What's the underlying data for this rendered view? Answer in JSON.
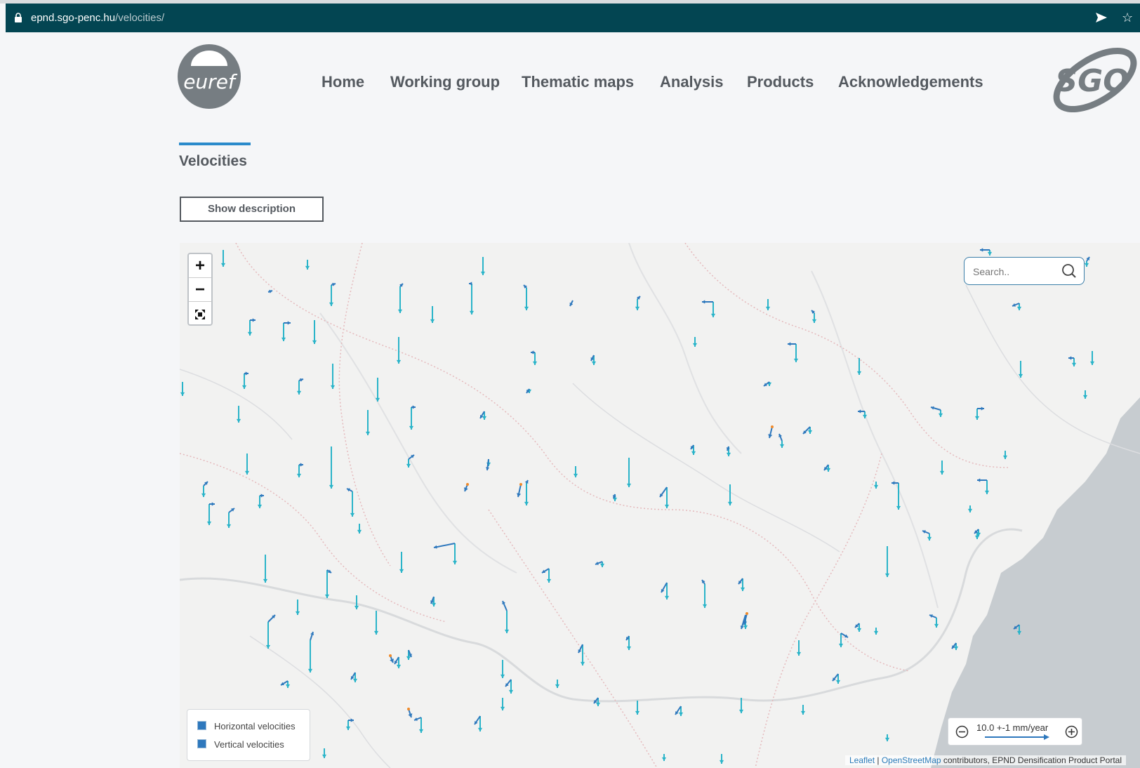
{
  "browser": {
    "url_host": "epnd.sgo-penc.hu",
    "url_path": "/velocities/"
  },
  "brand": {
    "euref_logo_text": "euref",
    "sgo_logo_text": "SGO"
  },
  "nav": {
    "items": [
      {
        "label": "Home"
      },
      {
        "label": "Working group"
      },
      {
        "label": "Thematic maps"
      },
      {
        "label": "Analysis"
      },
      {
        "label": "Products"
      },
      {
        "label": "Acknowledgements"
      }
    ]
  },
  "page": {
    "title": "Velocities",
    "show_description_label": "Show description"
  },
  "map": {
    "zoom_in_label": "+",
    "zoom_out_label": "−",
    "search_placeholder": "Search..",
    "legend": {
      "horizontal_label": "Horizontal velocities",
      "vertical_label": "Vertical velocities"
    },
    "scale_label": "10.0 +-1 mm/year",
    "attribution": {
      "leaflet": "Leaflet",
      "separator": " | ",
      "osm": "OpenStreetMap",
      "rest": " contributors, EPND Densification Product Portal"
    },
    "colors": {
      "vertical": "#2ab4c9",
      "horizontal": "#2e78bd",
      "uplift": "#f08a2a",
      "sea": "#c7ccd0"
    }
  }
}
